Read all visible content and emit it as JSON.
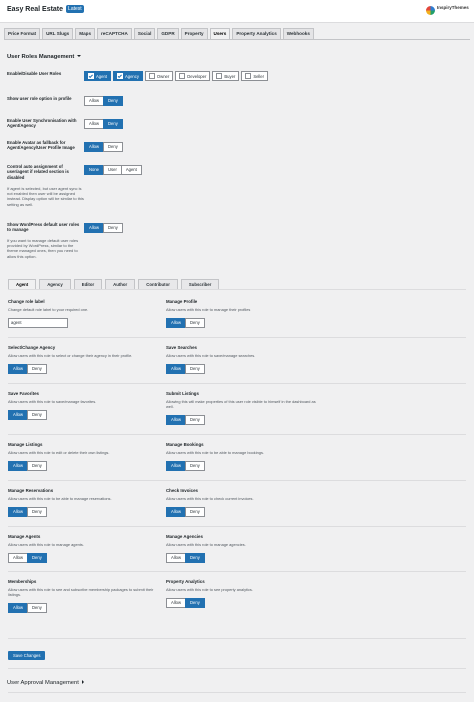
{
  "header": {
    "title": "Easy Real Estate",
    "badge": "Latest",
    "logo_line1": "InspiryThemes",
    "logo_line2": ""
  },
  "tabs": [
    "Price Format",
    "URL Slugs",
    "Maps",
    "reCAPTCHA",
    "Social",
    "GDPR",
    "Property",
    "Users",
    "Property Analytics",
    "Webhooks"
  ],
  "active_tab": "Users",
  "user_roles": {
    "title": "User Roles Management",
    "enable_label": "Enable/Disable User Roles",
    "roles": [
      {
        "label": "Agent",
        "checked": true
      },
      {
        "label": "Agency",
        "checked": true
      },
      {
        "label": "Owner",
        "checked": false
      },
      {
        "label": "Developer",
        "checked": false
      },
      {
        "label": "Buyer",
        "checked": false
      },
      {
        "label": "Seller",
        "checked": false
      }
    ],
    "show_role_label": "Show user role option in profile",
    "sync_label": "Enable User Synchronisation with Agent/Agency",
    "avatar_label": "Enable Avatar as fallback for Agent/Agency/User Profile Image",
    "auto_assign_label": "Control auto assignment of user/agent if related section is disabled",
    "auto_assign_help": "If agent is selected, but user agent sync is not enabled then user will be assigned instead. Display option will be similar to this setting as well.",
    "auto_assign_options": [
      "None",
      "User",
      "Agent"
    ],
    "wp_default_label": "Show WordPress default user roles to manage",
    "wp_default_help": "If you want to manage default user roles provided by WordPress, similar to the theme managed ones, then you need to allow this option.",
    "allow": "Allow",
    "deny": "Deny"
  },
  "subtabs": [
    "Agent",
    "Agency",
    "Editor",
    "Author",
    "Contributor",
    "Subscriber"
  ],
  "active_subtab": "Agent",
  "role_label": {
    "title": "Change role label",
    "desc": "Change default role label to your required one.",
    "value": "agent"
  },
  "capabilities": [
    {
      "title": "Manage Profile",
      "desc": "Allow users with this role to manage their profiles",
      "allowed": true
    },
    {
      "title": "Select/Change Agency",
      "desc": "Allow users with this role to select or change their agency in their profile.",
      "allowed": true
    },
    {
      "title": "Save Searches",
      "desc": "Allow users with this role to save/manage searches.",
      "allowed": true
    },
    {
      "title": "Save Favorites",
      "desc": "Allow users with this role to save/manage favorites.",
      "allowed": true
    },
    {
      "title": "Submit Listings",
      "desc": "Allowing this will make properties of this user role visible to himself in the dashboard as well.",
      "allowed": true
    },
    {
      "title": "Manage Listings",
      "desc": "Allow users with this role to edit or delete their own listings.",
      "allowed": true
    },
    {
      "title": "Manage Bookings",
      "desc": "Allow users with this role to be able to manage bookings.",
      "allowed": true
    },
    {
      "title": "Manage Reservations",
      "desc": "Allow users with this role to be able to manage reservations.",
      "allowed": true
    },
    {
      "title": "Check Invoices",
      "desc": "Allow users with this role to check current invoices.",
      "allowed": true
    },
    {
      "title": "Manage Agents",
      "desc": "Allow users with this role to manage agents.",
      "allowed": false
    },
    {
      "title": "Manage Agencies",
      "desc": "Allow users with this role to manage agencies.",
      "allowed": false
    },
    {
      "title": "Memberships",
      "desc": "Allow users with this role to see and subscribe membership packages to submit their listings.",
      "allowed": true
    },
    {
      "title": "Property Analytics",
      "desc": "Allow users with this role to see property analytics.",
      "allowed": false
    }
  ],
  "save_label": "Save Changes",
  "approval": {
    "title": "User Approval Management"
  }
}
